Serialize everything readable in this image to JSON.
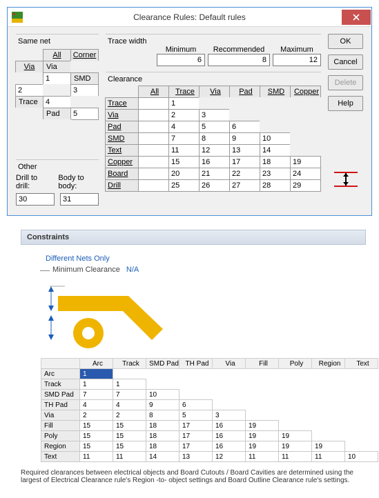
{
  "dialog": {
    "title": "Clearance Rules: Default rules",
    "same_net": {
      "label": "Same net",
      "col_headers": [
        "All",
        "Corner",
        "Via"
      ],
      "row_headers": [
        "Via",
        "SMD",
        "Trace",
        "Pad"
      ],
      "cells": {
        "via_all": "",
        "via_corner": "",
        "via_via": "1",
        "smd_all": "2",
        "smd_corner": "",
        "smd_via": "3",
        "trace_all": "4",
        "pad_all": "5"
      }
    },
    "other": {
      "label": "Other",
      "drill_label": "Drill to drill:",
      "body_label": "Body to body:",
      "drill_value": "30",
      "body_value": "31"
    },
    "trace_width": {
      "label": "Trace width",
      "min_label": "Minimum",
      "rec_label": "Recommended",
      "max_label": "Maximum",
      "min_value": "6",
      "rec_value": "8",
      "max_value": "12"
    },
    "clearance": {
      "label": "Clearance",
      "col_headers": [
        "All",
        "Trace",
        "Via",
        "Pad",
        "SMD",
        "Copper"
      ],
      "row_headers": [
        "Trace",
        "Via",
        "Pad",
        "SMD",
        "Text",
        "Copper",
        "Board",
        "Drill"
      ],
      "values": {
        "Trace": [
          "1"
        ],
        "Via": [
          "2",
          "3"
        ],
        "Pad": [
          "4",
          "5",
          "6"
        ],
        "SMD": [
          "7",
          "8",
          "9",
          "10"
        ],
        "Text": [
          "11",
          "12",
          "13",
          "14"
        ],
        "Copper": [
          "15",
          "16",
          "17",
          "18",
          "19"
        ],
        "Board": [
          "20",
          "21",
          "22",
          "23",
          "24"
        ],
        "Drill": [
          "25",
          "26",
          "27",
          "28",
          "29"
        ]
      }
    },
    "buttons": {
      "ok": "OK",
      "cancel": "Cancel",
      "delete": "Delete",
      "help": "Help"
    }
  },
  "constraints": {
    "header": "Constraints",
    "diff_nets": "Different Nets Only",
    "min_clear_label": "Minimum Clearance",
    "min_clear_value": "N/A",
    "col_headers": [
      "Arc",
      "Track",
      "SMD Pad",
      "TH Pad",
      "Via",
      "Fill",
      "Poly",
      "Region",
      "Text"
    ],
    "rows": [
      {
        "name": "Arc",
        "vals": [
          "1"
        ]
      },
      {
        "name": "Track",
        "vals": [
          "1",
          "1"
        ]
      },
      {
        "name": "SMD Pad",
        "vals": [
          "7",
          "7",
          "10"
        ]
      },
      {
        "name": "TH Pad",
        "vals": [
          "4",
          "4",
          "9",
          "6"
        ]
      },
      {
        "name": "Via",
        "vals": [
          "2",
          "2",
          "8",
          "5",
          "3"
        ]
      },
      {
        "name": "Fill",
        "vals": [
          "15",
          "15",
          "18",
          "17",
          "16",
          "19"
        ]
      },
      {
        "name": "Poly",
        "vals": [
          "15",
          "15",
          "18",
          "17",
          "16",
          "19",
          "19"
        ]
      },
      {
        "name": "Region",
        "vals": [
          "15",
          "15",
          "18",
          "17",
          "16",
          "19",
          "19",
          "19"
        ]
      },
      {
        "name": "Text",
        "vals": [
          "11",
          "11",
          "14",
          "13",
          "12",
          "11",
          "11",
          "11",
          "10"
        ]
      }
    ],
    "footnote": "Required clearances between electrical objects and Board Cutouts / Board Cavities are determined using the largest of Electrical Clearance rule's Region -to- object settings and Board Outline Clearance rule's settings."
  },
  "chart_data": [
    {
      "type": "table",
      "title": "Same net clearance matrix (mil)",
      "columns": [
        "All",
        "Corner",
        "Via"
      ],
      "rows": [
        "Via",
        "SMD",
        "Trace",
        "Pad"
      ],
      "values": [
        [
          null,
          null,
          1
        ],
        [
          2,
          null,
          3
        ],
        [
          4,
          null,
          null
        ],
        [
          5,
          null,
          null
        ]
      ]
    },
    {
      "type": "table",
      "title": "Clearance matrix (mil)",
      "columns": [
        "Trace",
        "Via",
        "Pad",
        "SMD",
        "Copper"
      ],
      "rows": [
        "Trace",
        "Via",
        "Pad",
        "SMD",
        "Text",
        "Copper",
        "Board",
        "Drill"
      ],
      "values": [
        [
          1,
          null,
          null,
          null,
          null
        ],
        [
          2,
          3,
          null,
          null,
          null
        ],
        [
          4,
          5,
          6,
          null,
          null
        ],
        [
          7,
          8,
          9,
          10,
          null
        ],
        [
          11,
          12,
          13,
          14,
          null
        ],
        [
          15,
          16,
          17,
          18,
          19
        ],
        [
          20,
          21,
          22,
          23,
          24
        ],
        [
          25,
          26,
          27,
          28,
          29
        ]
      ]
    },
    {
      "type": "table",
      "title": "Constraints minimum clearance matrix",
      "columns": [
        "Arc",
        "Track",
        "SMD Pad",
        "TH Pad",
        "Via",
        "Fill",
        "Poly",
        "Region",
        "Text"
      ],
      "rows": [
        "Arc",
        "Track",
        "SMD Pad",
        "TH Pad",
        "Via",
        "Fill",
        "Poly",
        "Region",
        "Text"
      ],
      "values": [
        [
          1,
          null,
          null,
          null,
          null,
          null,
          null,
          null,
          null
        ],
        [
          1,
          1,
          null,
          null,
          null,
          null,
          null,
          null,
          null
        ],
        [
          7,
          7,
          10,
          null,
          null,
          null,
          null,
          null,
          null
        ],
        [
          4,
          4,
          9,
          6,
          null,
          null,
          null,
          null,
          null
        ],
        [
          2,
          2,
          8,
          5,
          3,
          null,
          null,
          null,
          null
        ],
        [
          15,
          15,
          18,
          17,
          16,
          19,
          null,
          null,
          null
        ],
        [
          15,
          15,
          18,
          17,
          16,
          19,
          19,
          null,
          null
        ],
        [
          15,
          15,
          18,
          17,
          16,
          19,
          19,
          19,
          null
        ],
        [
          11,
          11,
          14,
          13,
          12,
          11,
          11,
          11,
          10
        ]
      ]
    }
  ]
}
